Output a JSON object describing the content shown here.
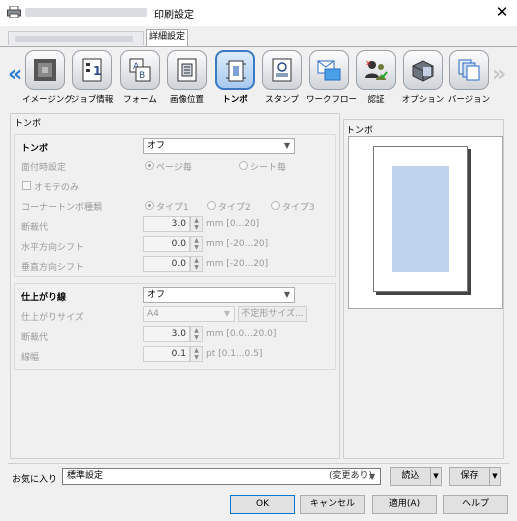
{
  "window": {
    "title": "印刷設定",
    "close_glyph": "✕",
    "icon": "printer-icon"
  },
  "tabs": [
    {
      "label": "詳細設定",
      "active": true
    }
  ],
  "ribbon": {
    "left_chevron": "«",
    "right_chevron": "»",
    "items": [
      {
        "label": "イメージング",
        "icon": "imaging-icon",
        "active": false
      },
      {
        "label": "ジョブ情報",
        "icon": "job-info-icon",
        "active": false
      },
      {
        "label": "フォーム",
        "icon": "form-icon",
        "active": false
      },
      {
        "label": "画像位置",
        "icon": "image-position-icon",
        "active": false
      },
      {
        "label": "トンボ",
        "icon": "crop-marks-icon",
        "active": true
      },
      {
        "label": "スタンプ",
        "icon": "stamp-icon",
        "active": false
      },
      {
        "label": "ワークフロー",
        "icon": "workflow-icon",
        "active": false
      },
      {
        "label": "認証",
        "icon": "authentication-icon",
        "active": false
      },
      {
        "label": "オプション",
        "icon": "options-icon",
        "active": false
      },
      {
        "label": "バージョン",
        "icon": "version-icon",
        "active": false
      }
    ]
  },
  "panel_title": "トンボ",
  "tombo": {
    "label": "トンボ",
    "value": "オフ",
    "duplex_label": "面付時設定",
    "duplex_options": [
      "ページ毎",
      "シート毎"
    ],
    "duplex_selected": 0,
    "front_only_label": "オモテのみ",
    "front_only_checked": false,
    "corner_label": "コーナートンボ種類",
    "corner_options": [
      "タイプ1",
      "タイプ2",
      "タイプ3"
    ],
    "corner_selected": 0,
    "bleed_label": "断裁代",
    "bleed_value": "3.0",
    "bleed_unit": "mm [0...20]",
    "hshift_label": "水平方向シフト",
    "hshift_value": "0.0",
    "hshift_unit": "mm [-20...20]",
    "vshift_label": "垂直方向シフト",
    "vshift_value": "0.0",
    "vshift_unit": "mm [-20...20]"
  },
  "finish": {
    "label": "仕上がり線",
    "value": "オフ",
    "size_label": "仕上がりサイズ",
    "size_value": "A4",
    "custom_size_button": "不定形サイズ...",
    "bleed_label": "断裁代",
    "bleed_value": "3.0",
    "bleed_unit": "mm [0.0...20.0]",
    "width_label": "線幅",
    "width_value": "0.1",
    "width_unit": "pt [0.1...0.5]"
  },
  "preview": {
    "title": "トンボ"
  },
  "favorites": {
    "label": "お気に入り",
    "value": "標準設定",
    "status": "(変更あり)",
    "load_button": "読込",
    "save_button": "保存"
  },
  "footer": {
    "ok": "OK",
    "cancel": "キャンセル",
    "apply": "適用(A)",
    "help": "ヘルプ"
  }
}
